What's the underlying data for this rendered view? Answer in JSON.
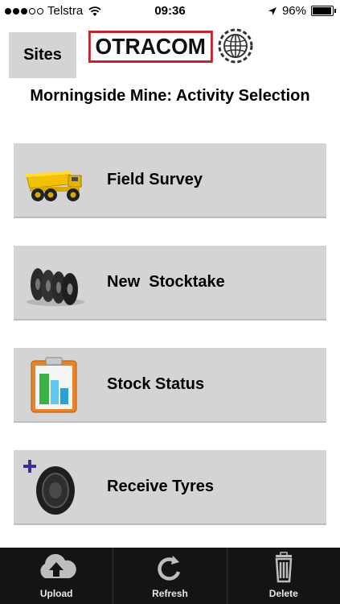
{
  "status_bar": {
    "carrier": "Telstra",
    "time": "09:36",
    "battery": "96%",
    "signal_filled": 3,
    "signal_total": 5
  },
  "header": {
    "sites_label": "Sites",
    "logo_text": "OTRACOM",
    "title": "Morningside Mine: Activity Selection"
  },
  "activities": [
    {
      "label": "Field Survey",
      "icon": "dump-truck-icon"
    },
    {
      "label": "New  Stocktake",
      "icon": "tyre-stack-icon"
    },
    {
      "label": "Stock Status",
      "icon": "clipboard-chart-icon"
    },
    {
      "label": "Receive Tyres",
      "icon": "tyre-plus-icon"
    }
  ],
  "toolbar": {
    "upload_label": "Upload",
    "refresh_label": "Refresh",
    "delete_label": "Delete"
  },
  "colors": {
    "button_bg": "#d4d4d4",
    "toolbar_bg": "#141414",
    "logo_red": "#c0262c",
    "truck_yellow": "#f2c200",
    "plus_purple": "#3b2f8f"
  }
}
